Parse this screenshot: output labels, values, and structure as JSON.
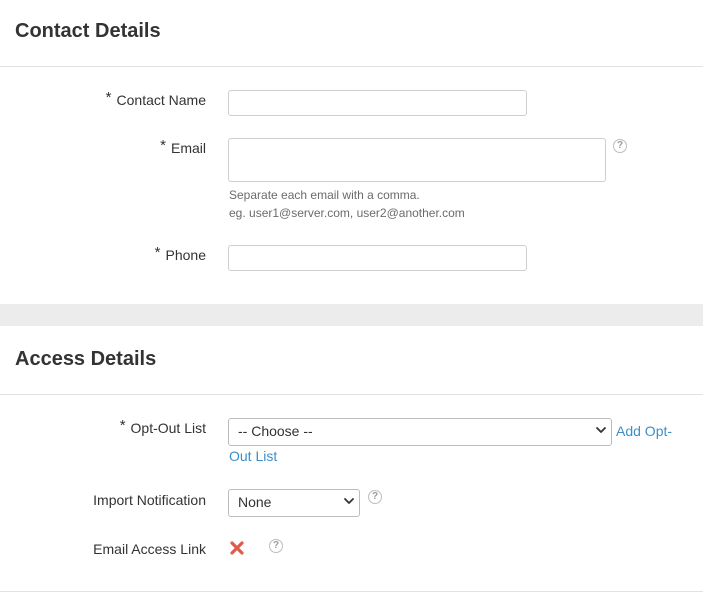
{
  "contact": {
    "title": "Contact Details",
    "required_marker": "*",
    "name_label": "Contact Name",
    "email_label": "Email",
    "email_help_line1": "Separate each email with a comma.",
    "email_help_line2": "eg. user1@server.com, user2@another.com",
    "phone_label": "Phone"
  },
  "access": {
    "title": "Access Details",
    "optout_label": "Opt-Out List",
    "optout_selected": "-- Choose --",
    "add_optout_line1": "Add Opt-",
    "add_optout_line2": "Out List",
    "import_label": "Import Notification",
    "import_selected": "None",
    "email_access_label": "Email Access Link",
    "email_access_state": "disabled"
  },
  "help_glyph": "?",
  "colors": {
    "link": "#3d8fc9",
    "disabled_x": "#e05a4e",
    "band": "#ececec",
    "divider": "#e2e2e2"
  },
  "icons": [
    "help-icon",
    "chevron-down-icon",
    "close-x-icon"
  ]
}
